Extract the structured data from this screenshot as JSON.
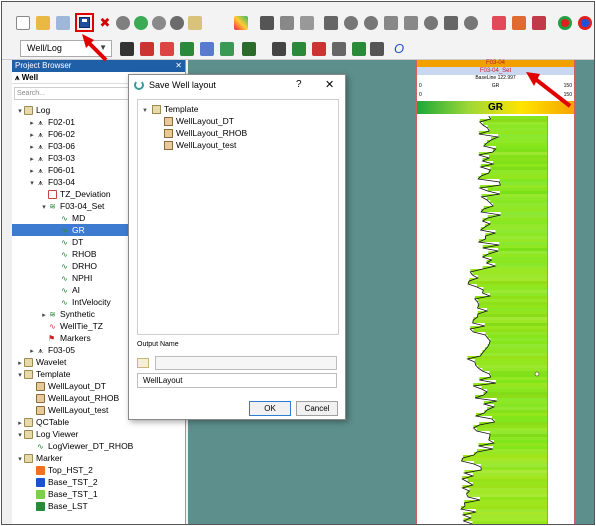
{
  "toolbar": {
    "well_selector_value": "Well/Log",
    "highlight_color": "#e00000"
  },
  "project_browser": {
    "title": "Project Browser",
    "root_tab": "Well",
    "search_placeholder": "Search...",
    "tree": [
      {
        "label": "Log",
        "type": "folder",
        "expanded": true
      },
      {
        "label": "F02-01",
        "type": "well"
      },
      {
        "label": "F06-02",
        "type": "well"
      },
      {
        "label": "F03-06",
        "type": "well"
      },
      {
        "label": "F03-03",
        "type": "well"
      },
      {
        "label": "F06-01",
        "type": "well"
      },
      {
        "label": "F03-04",
        "type": "well",
        "expanded": true
      },
      {
        "label": "TZ_Deviation",
        "type": "deviation"
      },
      {
        "label": "F03-04_Set",
        "type": "set",
        "expanded": true
      },
      {
        "label": "MD",
        "type": "log"
      },
      {
        "label": "GR",
        "type": "log",
        "selected": true
      },
      {
        "label": "DT",
        "type": "log"
      },
      {
        "label": "RHOB",
        "type": "log"
      },
      {
        "label": "DRHO",
        "type": "log"
      },
      {
        "label": "NPHI",
        "type": "log"
      },
      {
        "label": "AI",
        "type": "log"
      },
      {
        "label": "IntVelocity",
        "type": "log"
      },
      {
        "label": "Synthetic",
        "type": "set"
      },
      {
        "label": "WellTie_TZ",
        "type": "tie"
      },
      {
        "label": "Markers",
        "type": "marker"
      },
      {
        "label": "F03-05",
        "type": "well"
      },
      {
        "label": "Wavelet",
        "type": "folder"
      },
      {
        "label": "Template",
        "type": "folder",
        "expanded": true
      },
      {
        "label": "WellLayout_DT",
        "type": "template"
      },
      {
        "label": "WellLayout_RHOB",
        "type": "template"
      },
      {
        "label": "WellLayout_test",
        "type": "template"
      },
      {
        "label": "QCTable",
        "type": "folder"
      },
      {
        "label": "Log Viewer",
        "type": "folder",
        "expanded": true
      },
      {
        "label": "LogViewer_DT_RHOB",
        "type": "viewer"
      },
      {
        "label": "Marker",
        "type": "folder",
        "expanded": true
      },
      {
        "label": "Top_HST_2",
        "type": "marker-color",
        "color": "#f07020"
      },
      {
        "label": "Base_TST_2",
        "type": "marker-color",
        "color": "#1f4fd0"
      },
      {
        "label": "Base_TST_1",
        "type": "marker-color",
        "color": "#7ad048"
      },
      {
        "label": "Base_LST",
        "type": "marker-color",
        "color": "#2a8a3a"
      }
    ]
  },
  "track": {
    "well_name": "F03-04",
    "set_name": "F03-04_Set",
    "baseline": "BaseLine 122.997",
    "scale_left": "0",
    "scale_right": "150",
    "log_name": "GR",
    "scale2_left": "0",
    "scale2_right": "150"
  },
  "dialog": {
    "title": "Save Well layout",
    "help": "?",
    "close": "✕",
    "tree_root": "Template",
    "tree_items": [
      "WellLayout_DT",
      "WellLayout_RHOB",
      "WellLayout_test"
    ],
    "output_label": "Output Name",
    "output_name": "WellLayout",
    "ok_label": "OK",
    "cancel_label": "Cancel"
  },
  "icons": {
    "save": "save-icon",
    "folder": "folder-icon",
    "well": "well-icon",
    "log": "log-icon"
  }
}
